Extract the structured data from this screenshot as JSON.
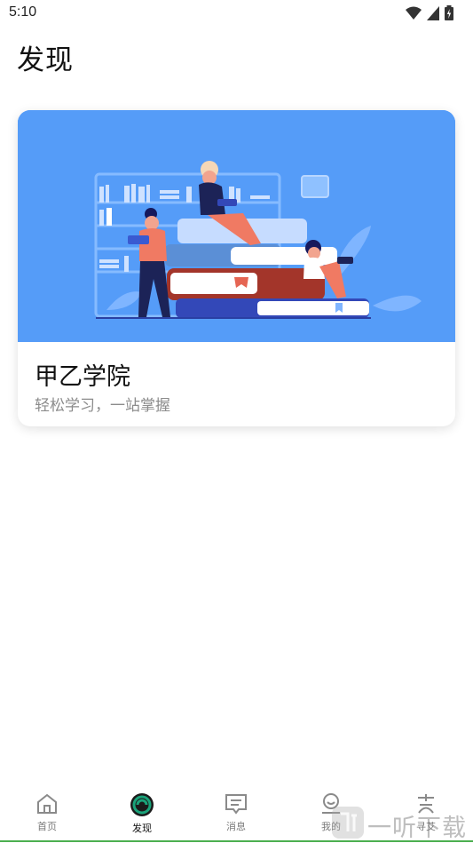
{
  "status_bar": {
    "time": "5:10"
  },
  "page": {
    "title": "发现"
  },
  "card": {
    "title": "甲乙学院",
    "subtitle": "轻松学习，一站掌握",
    "illustration_bg": "#559cf8"
  },
  "bottom_nav": {
    "active_index": 1,
    "accent": "#1aa37a",
    "items": [
      {
        "label": "首页",
        "icon": "home-icon"
      },
      {
        "label": "发现",
        "icon": "discover-icon"
      },
      {
        "label": "消息",
        "icon": "message-icon"
      },
      {
        "label": "我的",
        "icon": "profile-icon"
      },
      {
        "label": "寻艾",
        "icon": "xunai-icon"
      }
    ]
  },
  "watermark": {
    "text": "一听下载"
  }
}
